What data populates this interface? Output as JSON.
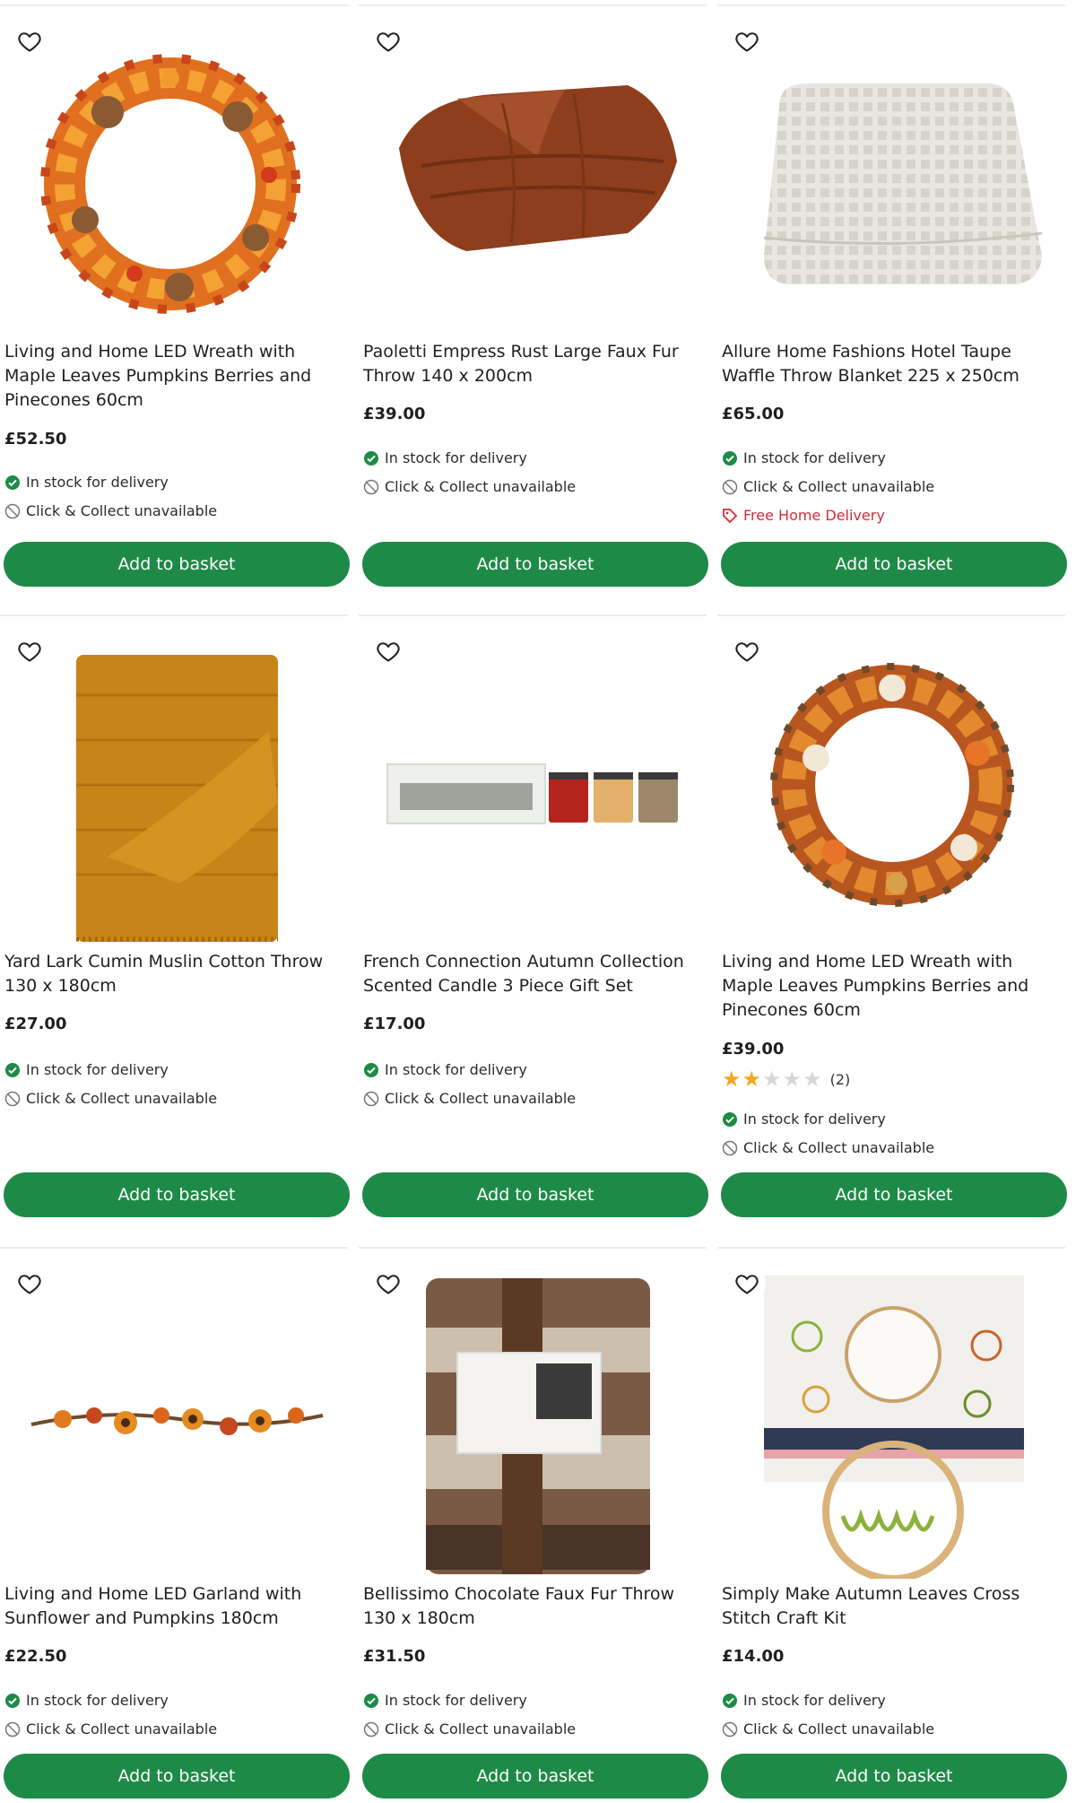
{
  "accent_color": "#1e8a47",
  "promo_color": "#d52b3a",
  "icons": {
    "wishlist": "heart-outline-icon",
    "in_stock": "check-circle-icon",
    "unavailable": "no-entry-icon",
    "promo": "tag-icon"
  },
  "products": [
    {
      "image": "autumn-maple-wreath",
      "title": "Living and Home LED Wreath with Maple Leaves Pumpkins Berries and Pinecones 60cm",
      "price": "£52.50",
      "delivery": "In stock for delivery",
      "collect": "Click & Collect unavailable",
      "button": "Add to basket"
    },
    {
      "image": "rust-faux-fur-throw",
      "title": "Paoletti Empress Rust Large Faux Fur Throw 140 x 200cm",
      "price": "£39.00",
      "delivery": "In stock for delivery",
      "collect": "Click & Collect unavailable",
      "button": "Add to basket"
    },
    {
      "image": "taupe-waffle-blanket",
      "title": "Allure Home Fashions Hotel Taupe Waffle Throw Blanket 225 x 250cm",
      "price": "£65.00",
      "delivery": "In stock for delivery",
      "collect": "Click & Collect unavailable",
      "promo": "Free Home Delivery",
      "button": "Add to basket"
    },
    {
      "image": "cumin-muslin-throw",
      "title": "Yard Lark Cumin Muslin Cotton Throw 130 x 180cm",
      "price": "£27.00",
      "delivery": "In stock for delivery",
      "collect": "Click & Collect unavailable",
      "button": "Add to basket"
    },
    {
      "image": "candle-gift-set",
      "title": "French Connection Autumn Collection Scented Candle 3 Piece Gift Set",
      "price": "£17.00",
      "delivery": "In stock for delivery",
      "collect": "Click & Collect unavailable",
      "button": "Add to basket"
    },
    {
      "image": "pumpkin-wreath",
      "title": "Living and Home LED Wreath with Maple Leaves Pumpkins Berries and Pinecones 60cm",
      "price": "£39.00",
      "rating": 2,
      "rating_max": 5,
      "rating_count": "(2)",
      "delivery": "In stock for delivery",
      "collect": "Click & Collect unavailable",
      "button": "Add to basket"
    },
    {
      "image": "sunflower-garland",
      "title": "Living and Home LED Garland with Sunflower and Pumpkins 180cm",
      "price": "£22.50",
      "delivery": "In stock for delivery",
      "collect": "Click & Collect unavailable",
      "button": "Add to basket"
    },
    {
      "image": "chocolate-faux-fur-throw",
      "title": "Bellissimo Chocolate Faux Fur Throw 130 x 180cm",
      "price": "£31.50",
      "delivery": "In stock for delivery",
      "collect": "Click & Collect unavailable",
      "button": "Add to basket"
    },
    {
      "image": "cross-stitch-kit",
      "title": "Simply Make Autumn Leaves Cross Stitch Craft Kit",
      "price": "£14.00",
      "delivery": "In stock for delivery",
      "collect": "Click & Collect unavailable",
      "button": "Add to basket"
    }
  ]
}
